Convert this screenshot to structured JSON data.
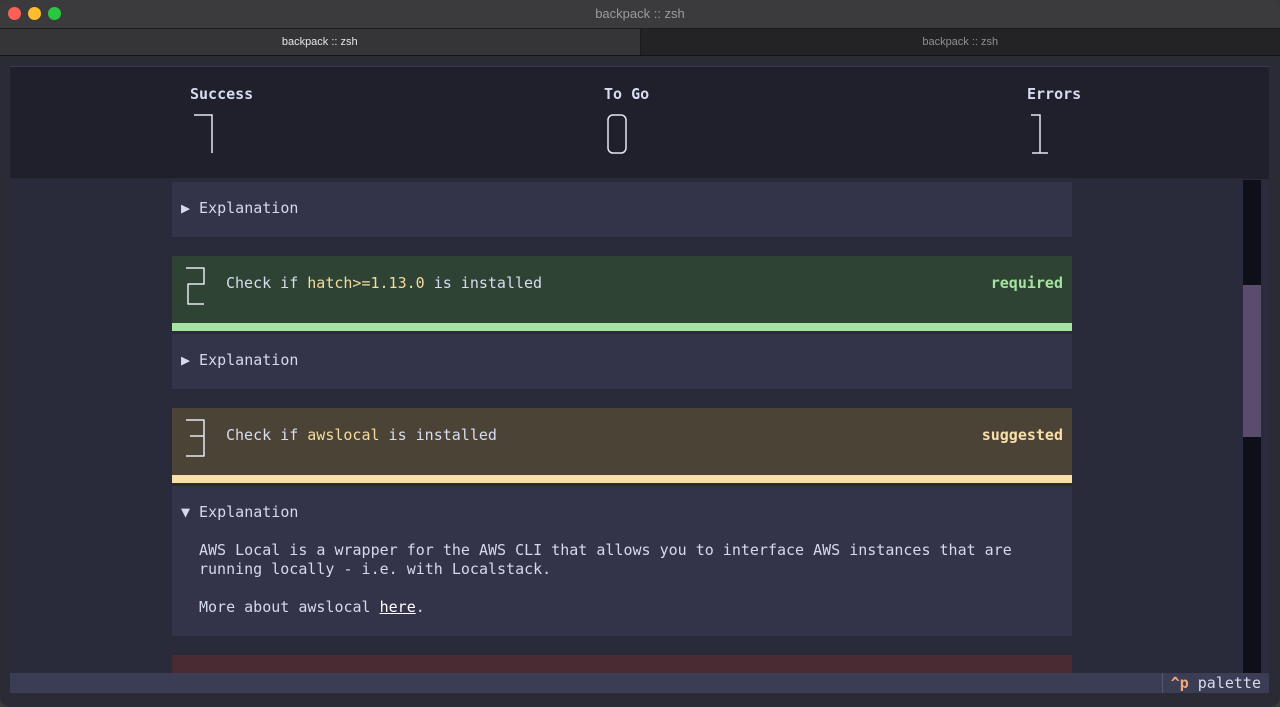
{
  "window": {
    "title": "backpack :: zsh"
  },
  "tabs": [
    {
      "label": "backpack :: zsh",
      "active": true
    },
    {
      "label": "backpack :: zsh",
      "active": false
    }
  ],
  "stats": {
    "success": {
      "label": "Success",
      "value": "7"
    },
    "to_go": {
      "label": "To Go",
      "value": "0"
    },
    "errors": {
      "label": "Errors",
      "value": "1"
    }
  },
  "items": {
    "explanation_1": {
      "label": "▶ Explanation"
    },
    "check_2": {
      "number": "2",
      "prefix": "Check if ",
      "package": "hatch>=1.13.0",
      "suffix": " is installed",
      "tag": "required",
      "bg": "#2e4333",
      "accent": "#a6e3a1"
    },
    "explanation_2": {
      "label": "▶ Explanation"
    },
    "check_3": {
      "number": "3",
      "prefix": "Check if ",
      "package": "awslocal",
      "suffix": " is installed",
      "tag": "suggested",
      "bg": "#4b4436",
      "accent": "#f9dfa8"
    },
    "explanation_3": {
      "label": "▼ Explanation",
      "line1": "AWS Local is a wrapper for the AWS CLI that allows you to interface AWS instances that are",
      "line2": "running locally - i.e. with Localstack.",
      "more_prefix": "More about awslocal ",
      "more_link": "here",
      "more_suffix": "."
    },
    "check_4": {
      "bg": "#4a2a33"
    }
  },
  "footer": {
    "key": "^p",
    "label": "palette"
  }
}
